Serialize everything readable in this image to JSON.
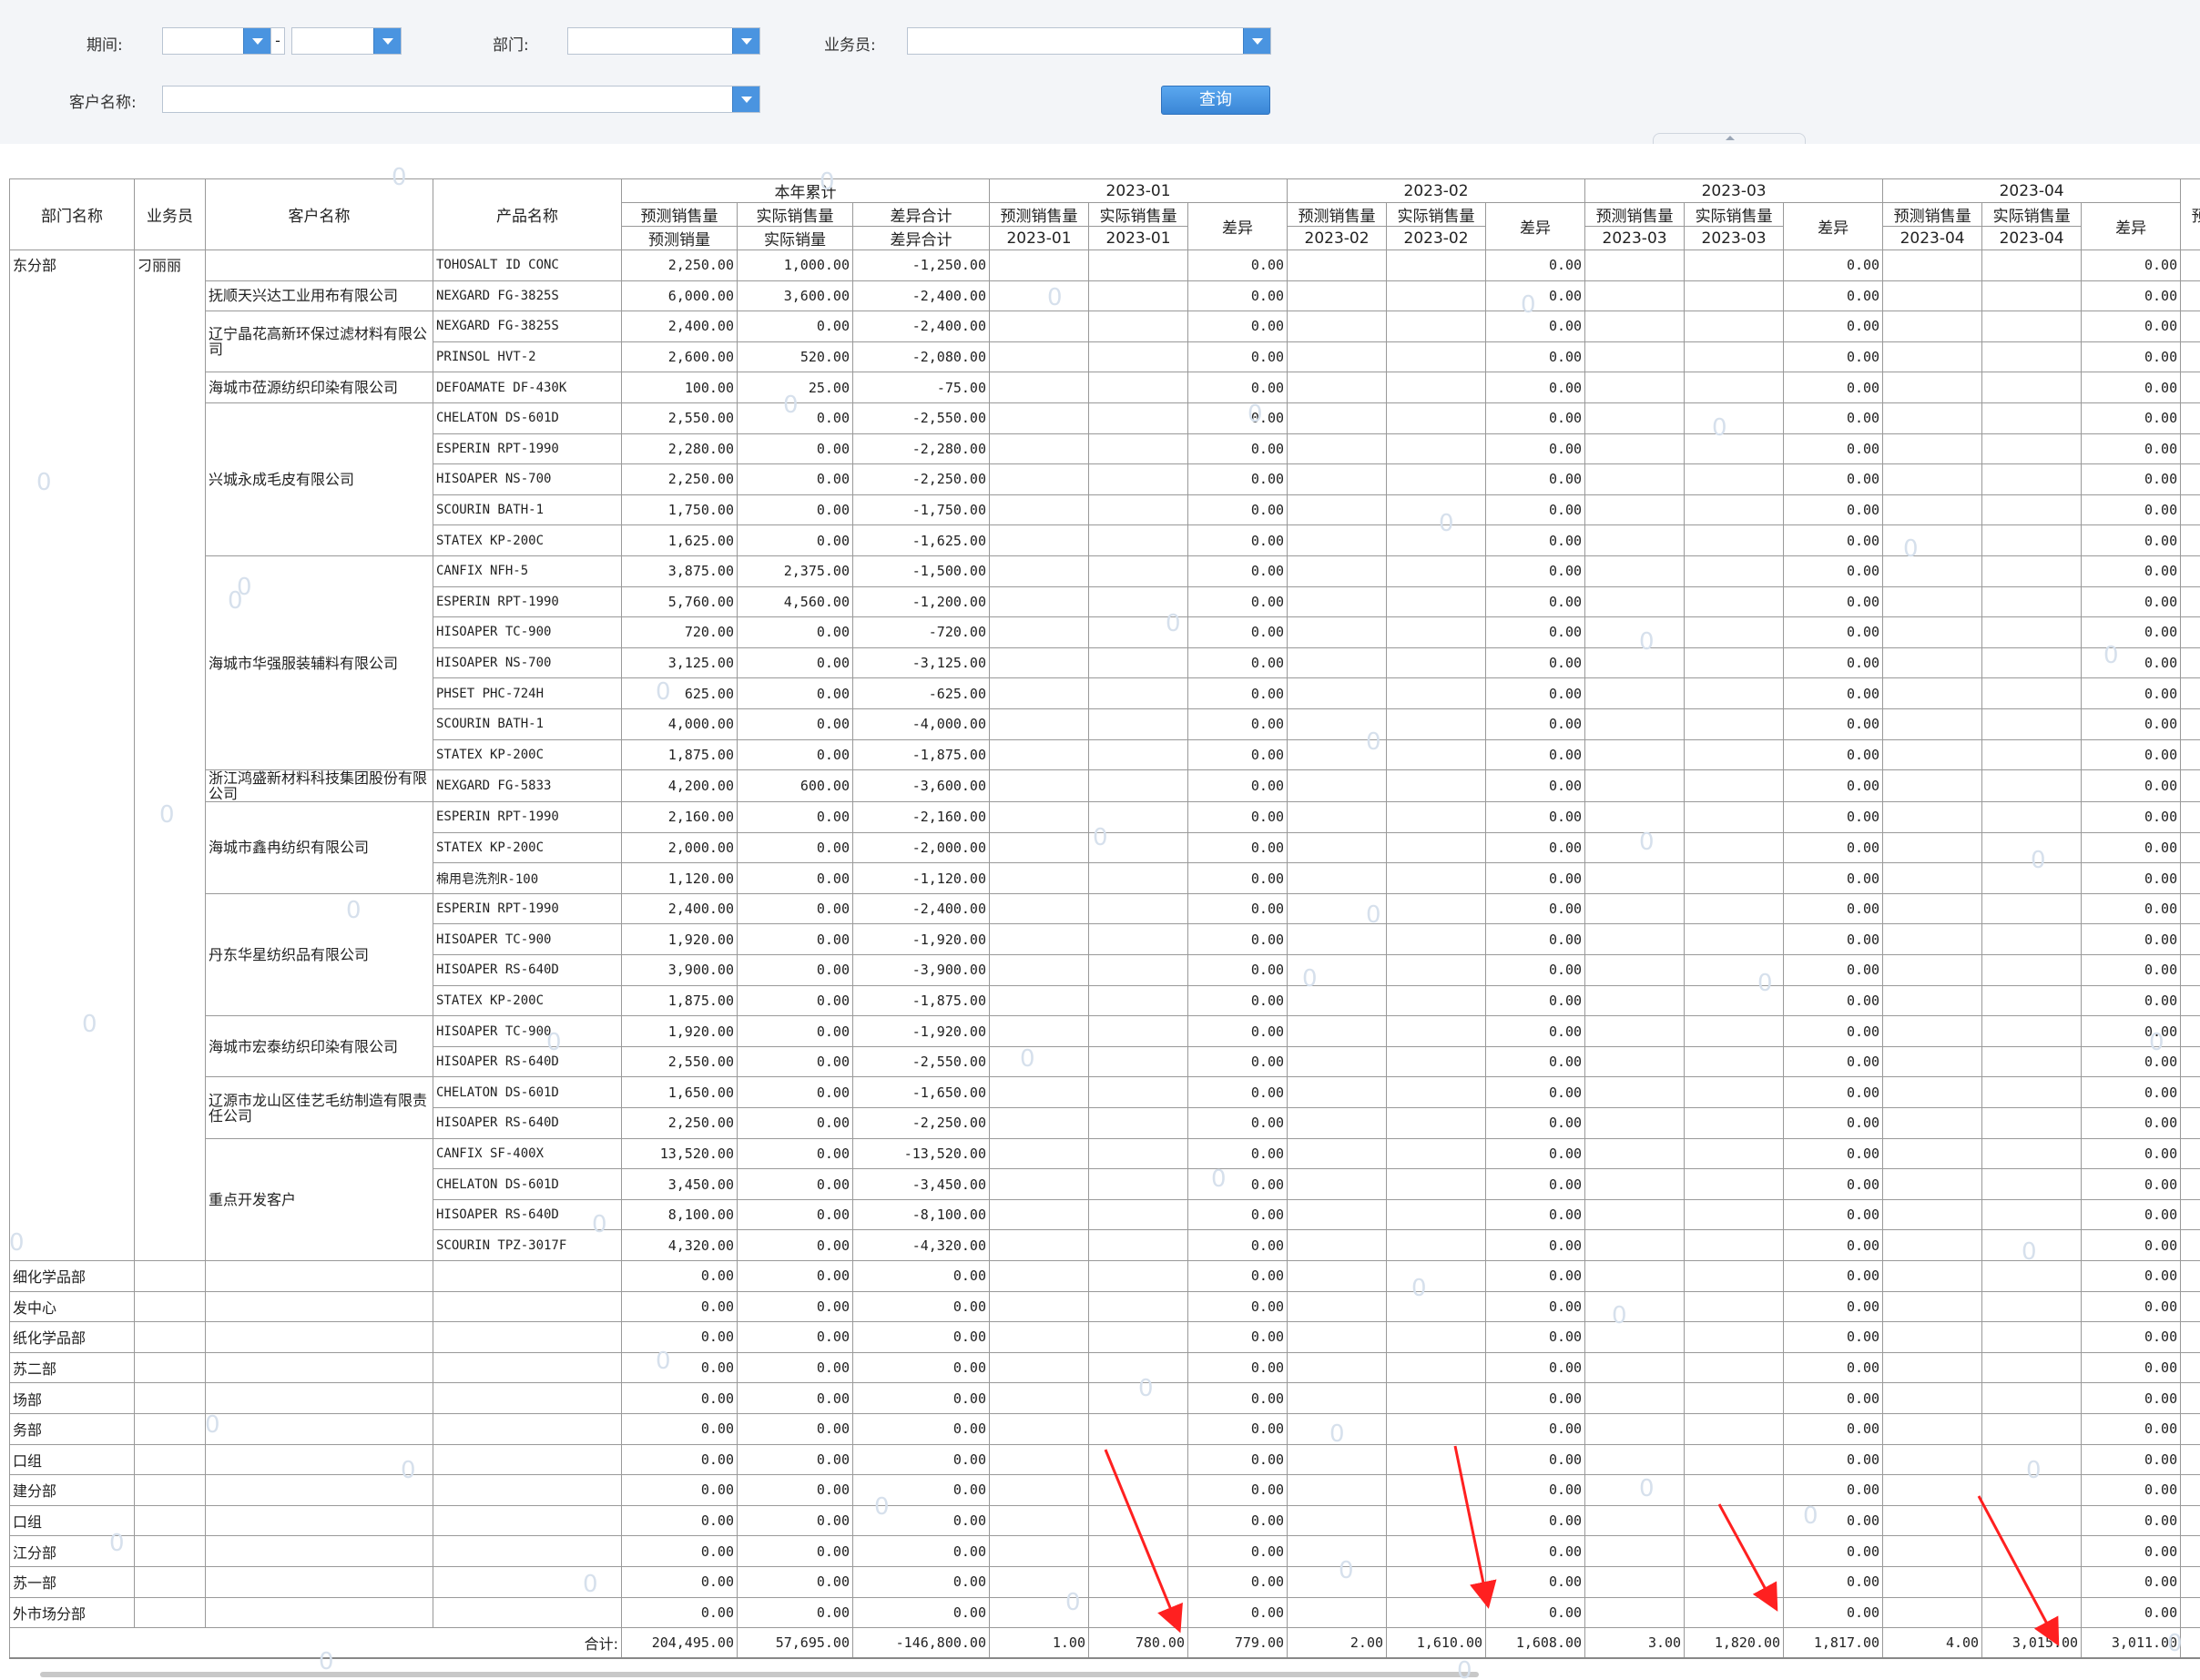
{
  "filters": {
    "period_label": "期间:",
    "dash": "-",
    "dept_label": "部门:",
    "salesman_label": "业务员:",
    "customer_label": "客户名称:",
    "query_label": "查询"
  },
  "header": {
    "dept": "部门名称",
    "salesman": "业务员",
    "customer": "客户名称",
    "product": "产品名称",
    "ytd": {
      "title": "本年累计",
      "forecast": "预测销售量",
      "actual": "实际销售量",
      "diff": "差异合计",
      "forecast2": "预测销量",
      "actual2": "实际销量",
      "diff2": "差异合计"
    },
    "months": [
      {
        "title": "2023-01",
        "forecast": "预测销售量",
        "actual": "实际销售量",
        "diff": "差异",
        "sub": "2023-01"
      },
      {
        "title": "2023-02",
        "forecast": "预测销售量",
        "actual": "实际销售量",
        "diff": "差异",
        "sub": "2023-02"
      },
      {
        "title": "2023-03",
        "forecast": "预测销售量",
        "actual": "实际销售量",
        "diff": "差异",
        "sub": "2023-03"
      },
      {
        "title": "2023-04",
        "forecast": "预测销售量",
        "actual": "实际销售量",
        "diff": "差异",
        "sub": "2023-04"
      }
    ],
    "overflow": "预"
  },
  "dept_main": "东分部",
  "salesman_main": "刁丽丽",
  "customers": [
    {
      "name": "",
      "products": [
        {
          "p": "TOHOSALT ID CONC",
          "f": "2,250.00",
          "a": "1,000.00",
          "d": "-1,250.00"
        }
      ]
    },
    {
      "name": "抚顺天兴达工业用布有限公司",
      "products": [
        {
          "p": "NEXGARD FG-3825S",
          "f": "6,000.00",
          "a": "3,600.00",
          "d": "-2,400.00"
        }
      ]
    },
    {
      "name": "辽宁晶花高新环保过滤材料有限公司",
      "products": [
        {
          "p": "NEXGARD FG-3825S",
          "f": "2,400.00",
          "a": "0.00",
          "d": "-2,400.00"
        },
        {
          "p": "PRINSOL HVT-2",
          "f": "2,600.00",
          "a": "520.00",
          "d": "-2,080.00"
        }
      ]
    },
    {
      "name": "海城市莅源纺织印染有限公司",
      "products": [
        {
          "p": "DEFOAMATE DF-430K",
          "f": "100.00",
          "a": "25.00",
          "d": "-75.00"
        }
      ]
    },
    {
      "name": "兴城永成毛皮有限公司",
      "products": [
        {
          "p": "CHELATON DS-601D",
          "f": "2,550.00",
          "a": "0.00",
          "d": "-2,550.00"
        },
        {
          "p": "ESPERIN RPT-1990",
          "f": "2,280.00",
          "a": "0.00",
          "d": "-2,280.00"
        },
        {
          "p": "HISOAPER NS-700",
          "f": "2,250.00",
          "a": "0.00",
          "d": "-2,250.00"
        },
        {
          "p": "SCOURIN BATH-1",
          "f": "1,750.00",
          "a": "0.00",
          "d": "-1,750.00"
        },
        {
          "p": "STATEX KP-200C",
          "f": "1,625.00",
          "a": "0.00",
          "d": "-1,625.00"
        }
      ]
    },
    {
      "name": "海城市华强服装辅料有限公司",
      "products": [
        {
          "p": "CANFIX NFH-5",
          "f": "3,875.00",
          "a": "2,375.00",
          "d": "-1,500.00"
        },
        {
          "p": "ESPERIN RPT-1990",
          "f": "5,760.00",
          "a": "4,560.00",
          "d": "-1,200.00"
        },
        {
          "p": "HISOAPER TC-900",
          "f": "720.00",
          "a": "0.00",
          "d": "-720.00"
        },
        {
          "p": "HISOAPER NS-700",
          "f": "3,125.00",
          "a": "0.00",
          "d": "-3,125.00"
        },
        {
          "p": "PHSET PHC-724H",
          "f": "625.00",
          "a": "0.00",
          "d": "-625.00"
        },
        {
          "p": "SCOURIN BATH-1",
          "f": "4,000.00",
          "a": "0.00",
          "d": "-4,000.00"
        },
        {
          "p": "STATEX KP-200C",
          "f": "1,875.00",
          "a": "0.00",
          "d": "-1,875.00"
        }
      ]
    },
    {
      "name": "浙江鸿盛新材料科技集团股份有限公司",
      "products": [
        {
          "p": "NEXGARD FG-5833",
          "f": "4,200.00",
          "a": "600.00",
          "d": "-3,600.00"
        }
      ]
    },
    {
      "name": "海城市鑫冉纺织有限公司",
      "products": [
        {
          "p": "ESPERIN RPT-1990",
          "f": "2,160.00",
          "a": "0.00",
          "d": "-2,160.00"
        },
        {
          "p": "STATEX KP-200C",
          "f": "2,000.00",
          "a": "0.00",
          "d": "-2,000.00"
        },
        {
          "p": "棉用皂洗剂R-100",
          "f": "1,120.00",
          "a": "0.00",
          "d": "-1,120.00"
        }
      ]
    },
    {
      "name": "丹东华星纺织品有限公司",
      "products": [
        {
          "p": "ESPERIN RPT-1990",
          "f": "2,400.00",
          "a": "0.00",
          "d": "-2,400.00"
        },
        {
          "p": "HISOAPER TC-900",
          "f": "1,920.00",
          "a": "0.00",
          "d": "-1,920.00"
        },
        {
          "p": "HISOAPER RS-640D",
          "f": "3,900.00",
          "a": "0.00",
          "d": "-3,900.00"
        },
        {
          "p": "STATEX KP-200C",
          "f": "1,875.00",
          "a": "0.00",
          "d": "-1,875.00"
        }
      ]
    },
    {
      "name": "海城市宏泰纺织印染有限公司",
      "products": [
        {
          "p": "HISOAPER TC-900",
          "f": "1,920.00",
          "a": "0.00",
          "d": "-1,920.00"
        },
        {
          "p": "HISOAPER RS-640D",
          "f": "2,550.00",
          "a": "0.00",
          "d": "-2,550.00"
        }
      ]
    },
    {
      "name": "辽源市龙山区佳艺毛纺制造有限责任公司",
      "products": [
        {
          "p": "CHELATON DS-601D",
          "f": "1,650.00",
          "a": "0.00",
          "d": "-1,650.00"
        },
        {
          "p": "HISOAPER RS-640D",
          "f": "2,250.00",
          "a": "0.00",
          "d": "-2,250.00"
        }
      ]
    },
    {
      "name": "重点开发客户",
      "products": [
        {
          "p": "CANFIX SF-400X",
          "f": "13,520.00",
          "a": "0.00",
          "d": "-13,520.00"
        },
        {
          "p": "CHELATON DS-601D",
          "f": "3,450.00",
          "a": "0.00",
          "d": "-3,450.00"
        },
        {
          "p": "HISOAPER RS-640D",
          "f": "8,100.00",
          "a": "0.00",
          "d": "-8,100.00"
        },
        {
          "p": "SCOURIN TPZ-3017F",
          "f": "4,320.00",
          "a": "0.00",
          "d": "-4,320.00"
        }
      ]
    }
  ],
  "zero": "0.00",
  "other_depts": [
    "细化学品部",
    "发中心",
    "纸化学品部",
    "苏二部",
    "场部",
    "务部",
    "口组",
    "建分部",
    "口组",
    "江分部",
    "苏一部",
    "外市场分部"
  ],
  "total": {
    "label": "合计:",
    "ytd_f": "204,495.00",
    "ytd_a": "57,695.00",
    "ytd_d": "-146,800.00",
    "months": [
      {
        "f": "1.00",
        "a": "780.00",
        "d": "779.00"
      },
      {
        "f": "2.00",
        "a": "1,610.00",
        "d": "1,608.00"
      },
      {
        "f": "3.00",
        "a": "1,820.00",
        "d": "1,817.00"
      },
      {
        "f": "4.00",
        "a": "3,015.00",
        "d": "3,011.00"
      }
    ]
  },
  "watermark": "0",
  "colors": {
    "annotation_arrow": "#ff2020",
    "button": "#3a86d6",
    "dropdown": "#4a94e0"
  }
}
